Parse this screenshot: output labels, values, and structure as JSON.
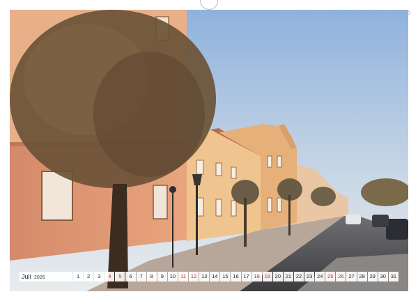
{
  "calendar": {
    "month": "Juli",
    "year": "2026",
    "weekend_color": "#e02020",
    "days": [
      {
        "n": "1",
        "we": false
      },
      {
        "n": "2",
        "we": false
      },
      {
        "n": "3",
        "we": false
      },
      {
        "n": "4",
        "we": true
      },
      {
        "n": "5",
        "we": true
      },
      {
        "n": "6",
        "we": false
      },
      {
        "n": "7",
        "we": false
      },
      {
        "n": "8",
        "we": false
      },
      {
        "n": "9",
        "we": false
      },
      {
        "n": "10",
        "we": false
      },
      {
        "n": "11",
        "we": true
      },
      {
        "n": "12",
        "we": true
      },
      {
        "n": "13",
        "we": false
      },
      {
        "n": "14",
        "we": false
      },
      {
        "n": "15",
        "we": false
      },
      {
        "n": "16",
        "we": false
      },
      {
        "n": "17",
        "we": false
      },
      {
        "n": "18",
        "we": true
      },
      {
        "n": "19",
        "we": true
      },
      {
        "n": "20",
        "we": false
      },
      {
        "n": "21",
        "we": false
      },
      {
        "n": "22",
        "we": false
      },
      {
        "n": "23",
        "we": false
      },
      {
        "n": "24",
        "we": false
      },
      {
        "n": "25",
        "we": true
      },
      {
        "n": "26",
        "we": true
      },
      {
        "n": "27",
        "we": false
      },
      {
        "n": "28",
        "we": false
      },
      {
        "n": "29",
        "we": false
      },
      {
        "n": "30",
        "we": false
      },
      {
        "n": "31",
        "we": false
      }
    ]
  },
  "photo": {
    "subject": "street-with-trees-and-historic-buildings",
    "sky_top_color": "#8fb2dc",
    "sky_bottom_color": "#e6ebef",
    "facade_color": "#e8b98a",
    "wall_color": "#d98e6e"
  }
}
